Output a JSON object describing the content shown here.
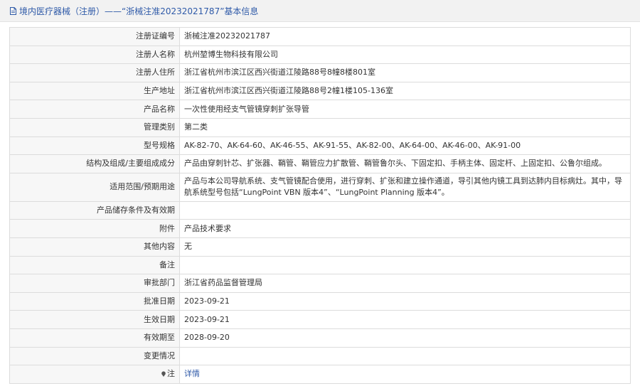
{
  "header": {
    "title": "境内医疗器械（注册）——“浙械注准20232021787”基本信息"
  },
  "rows": [
    {
      "label": "注册证编号",
      "value": "浙械注准20232021787"
    },
    {
      "label": "注册人名称",
      "value": "杭州堃博生物科技有限公司"
    },
    {
      "label": "注册人住所",
      "value": "浙江省杭州市滨江区西兴街道江陵路88号8幢8楼801室"
    },
    {
      "label": "生产地址",
      "value": "浙江省杭州市滨江区西兴街道江陵路88号2幢1楼105-136室"
    },
    {
      "label": "产品名称",
      "value": "一次性使用经支气管镜穿刺扩张导管"
    },
    {
      "label": "管理类别",
      "value": "第二类"
    },
    {
      "label": "型号规格",
      "value": "AK-82-70、AK-64-60、AK-46-55、AK-91-55、AK-82-00、AK-64-00、AK-46-00、AK-91-00"
    },
    {
      "label": "结构及组成/主要组成成分",
      "value": "产品由穿刺针芯、扩张器、鞘管、鞘管应力扩散管、鞘管鲁尔头、下固定扣、手柄主体、固定杆、上固定扣、公鲁尔组成。"
    },
    {
      "label": "适用范围/预期用途",
      "value": "产品与本公司导航系统、支气管镜配合使用，进行穿刺、扩张和建立操作通道，导引其他内镜工具到达肺内目标病灶。其中，导航系统型号包括“LungPoint VBN 版本4”、“LungPoint Planning 版本4”。"
    },
    {
      "label": "产品储存条件及有效期",
      "value": ""
    },
    {
      "label": "附件",
      "value": "产品技术要求"
    },
    {
      "label": "其他内容",
      "value": "无"
    },
    {
      "label": "备注",
      "value": ""
    },
    {
      "label": "审批部门",
      "value": "浙江省药品监督管理局"
    },
    {
      "label": "批准日期",
      "value": "2023-09-21"
    },
    {
      "label": "生效日期",
      "value": "2023-09-21"
    },
    {
      "label": "有效期至",
      "value": "2028-09-20"
    },
    {
      "label": "变更情况",
      "value": ""
    }
  ],
  "note_row": {
    "label": "注",
    "link_text": "详情"
  }
}
